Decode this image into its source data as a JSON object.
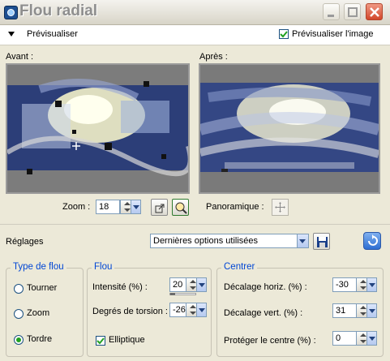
{
  "window": {
    "title": "Flou radial"
  },
  "preview_bar": {
    "toggle_label": "Prévisualiser",
    "preview_image_label": "Prévisualiser l'image",
    "preview_image_checked": true
  },
  "panels": {
    "before_label": "Avant :",
    "after_label": "Après :"
  },
  "zoom": {
    "label": "Zoom :",
    "value": "18"
  },
  "pan": {
    "label": "Panoramique :"
  },
  "settings": {
    "label": "Réglages",
    "preset_value": "Dernières options utilisées"
  },
  "blur_type": {
    "title": "Type de flou",
    "options": [
      "Tourner",
      "Zoom",
      "Tordre"
    ],
    "selected": "Tordre"
  },
  "blur": {
    "title": "Flou",
    "intensity_label": "Intensité (%) :",
    "intensity_value": "20",
    "intensity_level": 0.2,
    "twist_label": "Degrés de torsion :",
    "twist_value": "-26",
    "elliptic_label": "Elliptique",
    "elliptic_checked": true
  },
  "center": {
    "title": "Centrer",
    "hshift_label": "Décalage horiz. (%) :",
    "hshift_value": "-30",
    "vshift_label": "Décalage vert. (%) :",
    "vshift_value": "31",
    "protect_label": "Protéger le centre (%) :",
    "protect_value": "0"
  },
  "colors": {
    "accent": "#0046d5",
    "radio_selected": "#21a121",
    "close_button": "#d2472a"
  }
}
